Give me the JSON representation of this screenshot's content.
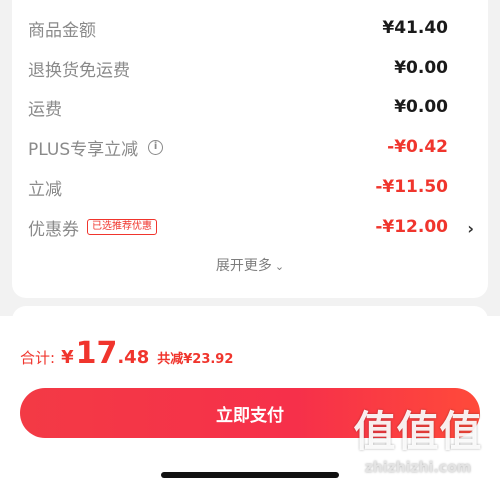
{
  "summary": {
    "rows": [
      {
        "label": "商品金额",
        "value": "¥41.40"
      },
      {
        "label": "退换货免运费",
        "value": "¥0.00"
      },
      {
        "label": "运费",
        "value": "¥0.00"
      },
      {
        "label": "PLUS专享立减",
        "value": "-¥0.42"
      },
      {
        "label": "立减",
        "value": "-¥11.50"
      },
      {
        "label": "优惠券",
        "value": "-¥12.00",
        "tag": "已选推荐优惠"
      }
    ],
    "expand_label": "展开更多"
  },
  "footer": {
    "total_label": "合计:",
    "currency": "¥",
    "amount_int": "17",
    "amount_dec": ".48",
    "saved_text": "共减¥23.92",
    "pay_label": "立即支付"
  },
  "watermark": {
    "big": "值值值",
    "small": "zhizhizhi.com"
  },
  "colors": {
    "accent": "#f0352d",
    "button": "#f33a45",
    "background": "#f2f2f2"
  }
}
